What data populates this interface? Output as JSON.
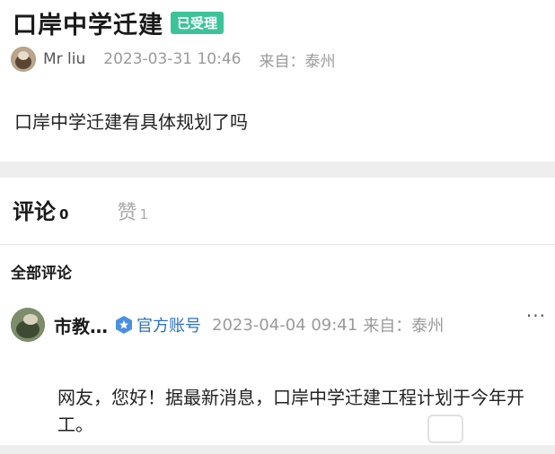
{
  "post": {
    "title": "口岸中学迁建",
    "status_badge": "已受理",
    "author": "Mr liu",
    "date": "2023-03-31 10:46",
    "source": "来自：泰州",
    "question": "口岸中学迁建有具体规划了吗"
  },
  "tabs": {
    "comments_label": "评论",
    "comments_count": "0",
    "likes_label": "赞",
    "likes_count": "1"
  },
  "comments_section": {
    "title": "全部评论",
    "items": [
      {
        "author": "市教…",
        "verified_label": "官方账号",
        "date": "2023-04-04 09:41",
        "source": "来自：泰州",
        "more": "···",
        "body": "网友，您好！据最新消息，口岸中学迁建工程计划于今年开工。"
      }
    ]
  },
  "colors": {
    "badge": "#3cc39a",
    "verified": "#2d6fc4",
    "band": "#eeeeee"
  }
}
